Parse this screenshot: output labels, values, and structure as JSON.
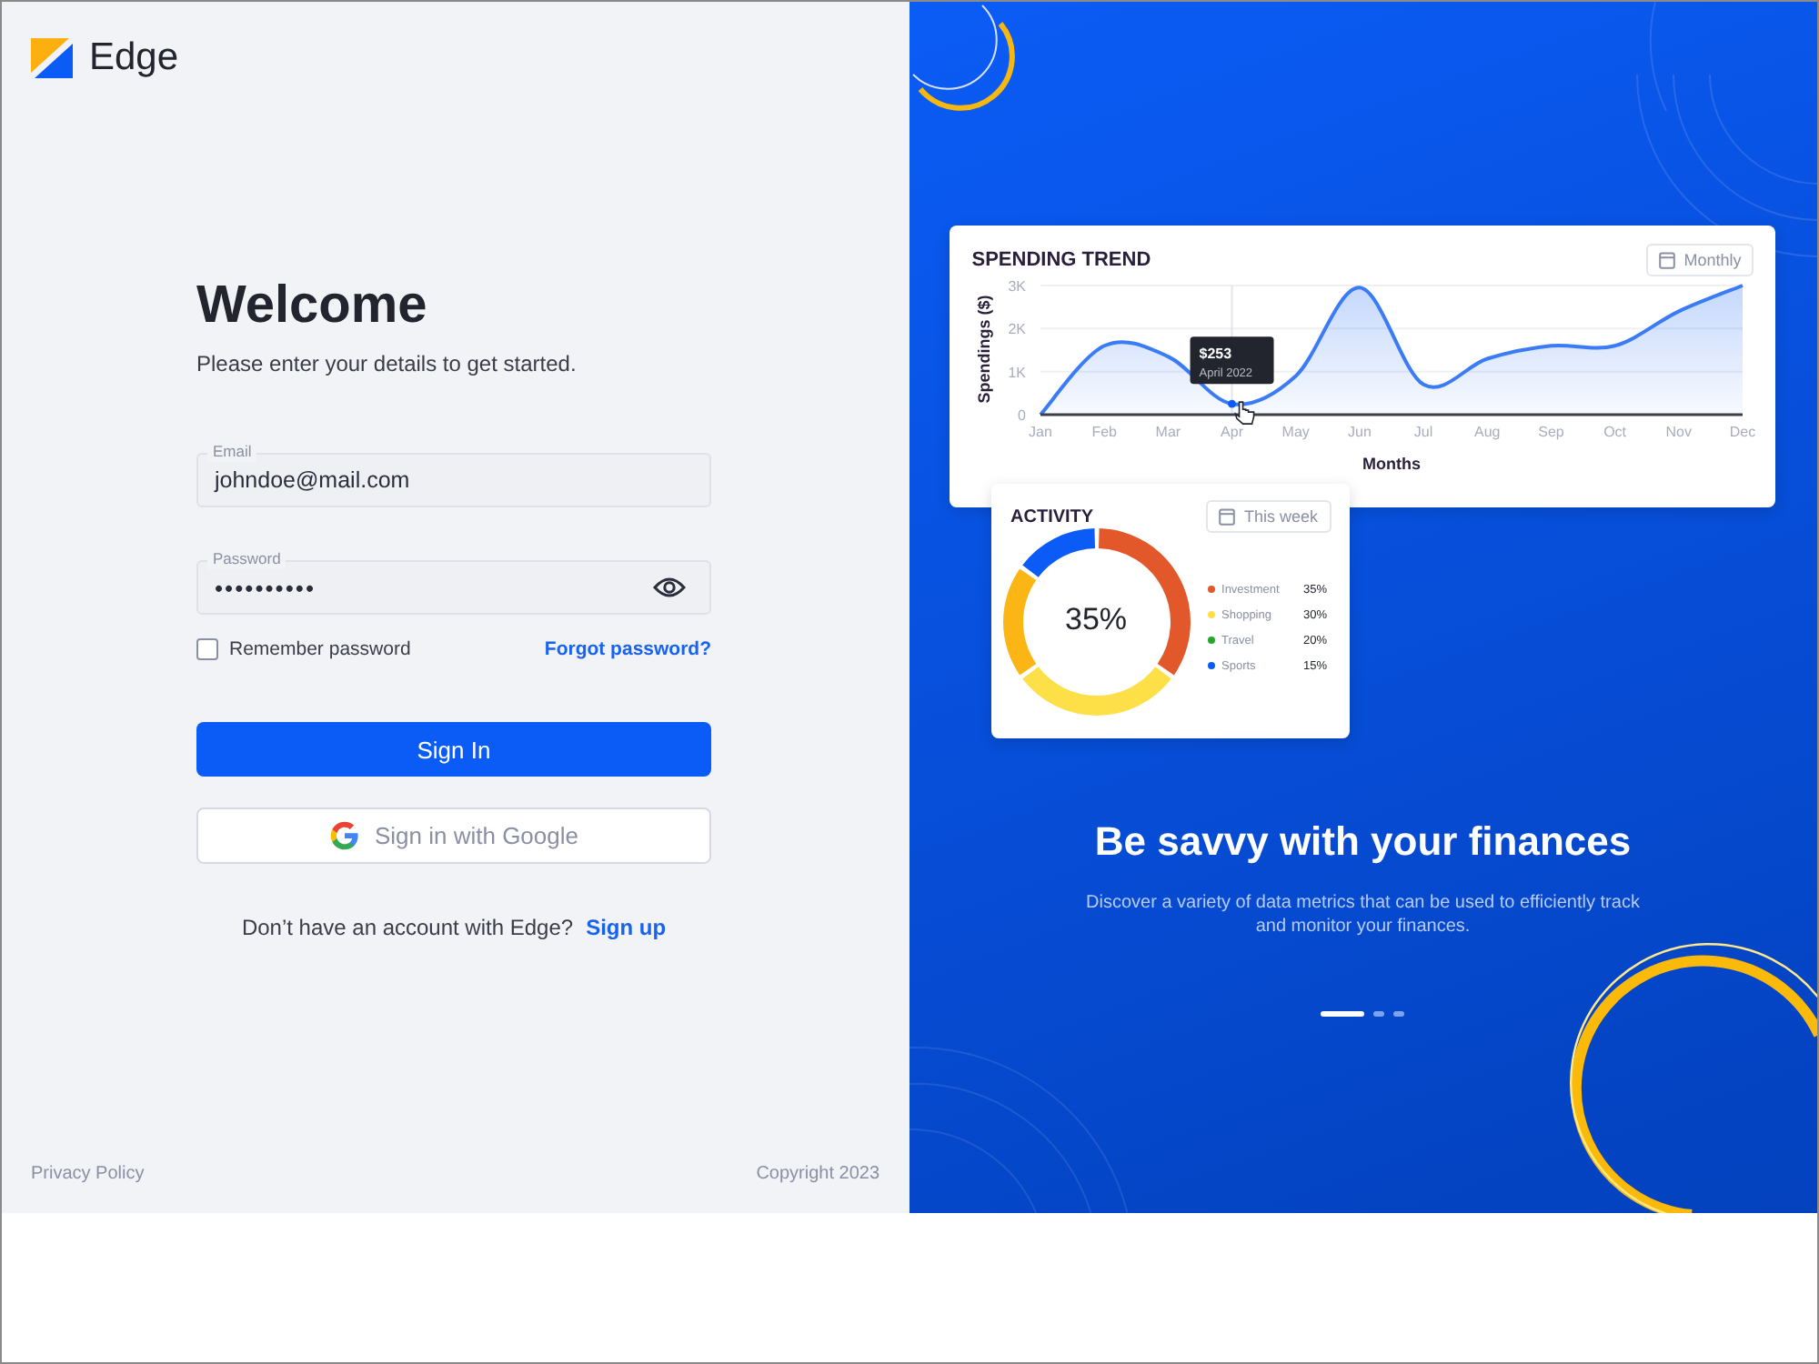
{
  "logo": {
    "name": "Edge"
  },
  "welcome": {
    "title": "Welcome",
    "subtitle": "Please enter your details to get started."
  },
  "fields": [
    {
      "label": "Email",
      "value": "johndoe@mail.com",
      "kind": "text"
    },
    {
      "label": "Password",
      "value": "••••••••••",
      "kind": "password"
    }
  ],
  "remember": {
    "label": "Remember password",
    "checked": false
  },
  "forgot_link": "Forgot password?",
  "sign_in_button": "Sign In",
  "google_button": "Sign in with Google",
  "signup": {
    "text": "Don’t have an account with Edge?",
    "link": "Sign up"
  },
  "footer": {
    "privacy": "Privacy Policy",
    "copyright": "Copyright 2023"
  },
  "spending_card": {
    "title": "SPENDING TREND",
    "period": "Monthly",
    "chart_data": {
      "type": "area",
      "xlabel": "Months",
      "ylabel": "Spendings ($)",
      "categories": [
        "Jan",
        "Feb",
        "Mar",
        "Apr",
        "May",
        "Jun",
        "Jul",
        "Aug",
        "Sep",
        "Oct",
        "Nov",
        "Dec"
      ],
      "series": [
        {
          "color": "#3b7cf6",
          "values": [
            0,
            1600,
            1350,
            250,
            900,
            2950,
            700,
            1300,
            1600,
            1600,
            2400,
            3000
          ]
        }
      ],
      "ylim": [
        0,
        3000
      ],
      "yticks": [
        {
          "value": 0,
          "label": "0"
        },
        {
          "value": 1000,
          "label": "1K"
        },
        {
          "value": 2000,
          "label": "2K"
        },
        {
          "value": 3000,
          "label": "3K"
        }
      ],
      "ref_lines": [
        {
          "axis": "x",
          "value": "Apr"
        }
      ]
    },
    "tooltip": {
      "value": "$253",
      "date": "April 2022"
    }
  },
  "activity_card": {
    "title": "ACTIVITY",
    "period": "This week",
    "center_label": "35%",
    "legend": [
      {
        "value": "35%",
        "color": "#e2582a"
      },
      {
        "value": "30%",
        "color": "#fde047"
      },
      {
        "value": "20%",
        "color": "#22a82a"
      },
      {
        "value": "15%",
        "color": "#0b5cf6"
      }
    ],
    "chart_data": {
      "type": "donut",
      "categories": [
        "Investment",
        "Shopping",
        "Travel",
        "Sports"
      ],
      "values": [
        35,
        30,
        20,
        15
      ]
    }
  },
  "promo": {
    "title": "Be savvy with your finances",
    "text": "Discover a variety of data metrics that can be used to efficiently track and monitor your finances."
  },
  "carousel": [
    {
      "selected": true
    },
    {
      "selected": false
    },
    {
      "selected": false
    }
  ]
}
